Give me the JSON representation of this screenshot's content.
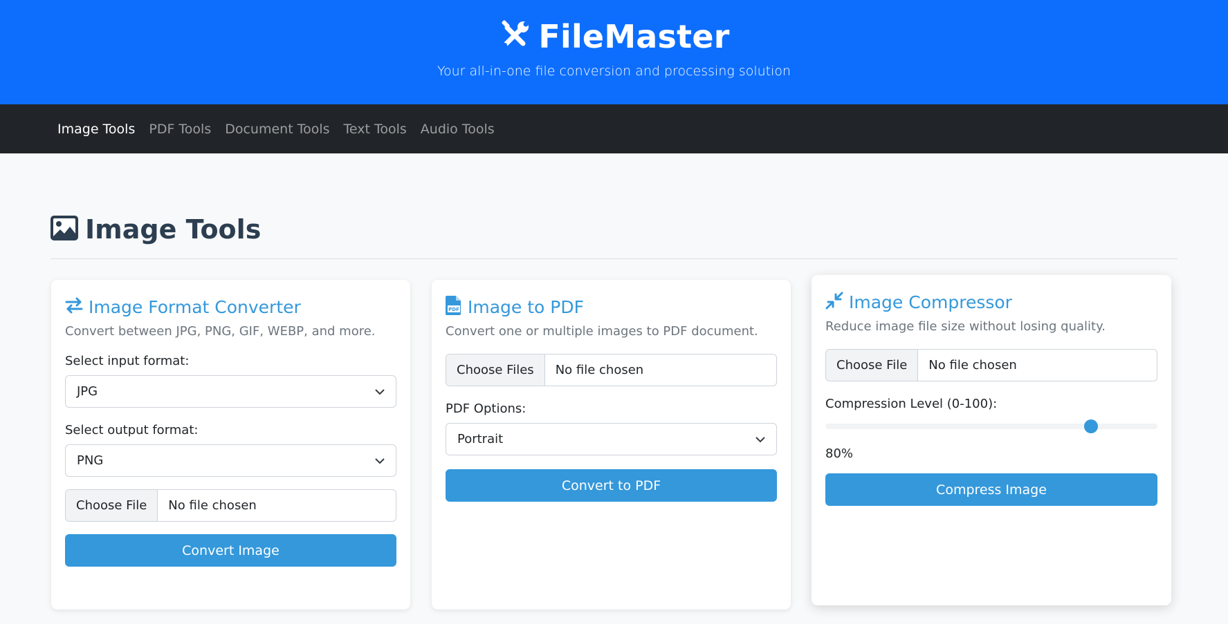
{
  "app": {
    "title": "FileMaster",
    "tagline": "Your all-in-one file conversion and processing solution"
  },
  "nav": {
    "items": [
      "Image Tools",
      "PDF Tools",
      "Document Tools",
      "Text Tools",
      "Audio Tools"
    ],
    "active": "Image Tools"
  },
  "section": {
    "title": "Image Tools"
  },
  "converter": {
    "title": "Image Format Converter",
    "description": "Convert between JPG, PNG, GIF, WEBP, and more.",
    "input_label": "Select input format:",
    "input_value": "JPG",
    "output_label": "Select output format:",
    "output_value": "PNG",
    "file_button": "Choose File",
    "file_status": "No file chosen",
    "submit": "Convert Image"
  },
  "image_to_pdf": {
    "title": "Image to PDF",
    "description": "Convert one or multiple images to PDF document.",
    "file_button": "Choose Files",
    "file_status": "No file chosen",
    "options_label": "PDF Options:",
    "options_value": "Portrait",
    "submit": "Convert to PDF"
  },
  "compressor": {
    "title": "Image Compressor",
    "description": "Reduce image file size without losing quality.",
    "file_button": "Choose File",
    "file_status": "No file chosen",
    "level_label": "Compression Level (0-100):",
    "level_value": 80,
    "level_text": "80%",
    "submit": "Compress Image"
  },
  "colors": {
    "header": "#0d6efd",
    "nav": "#212529",
    "accent": "#3498db",
    "heading": "#2c3e50"
  },
  "icons": {
    "brand": "tools-icon",
    "section": "image-icon",
    "converter": "exchange-icon",
    "pdf": "file-pdf-icon",
    "compressor": "compress-icon",
    "select": "chevron-down-icon"
  }
}
